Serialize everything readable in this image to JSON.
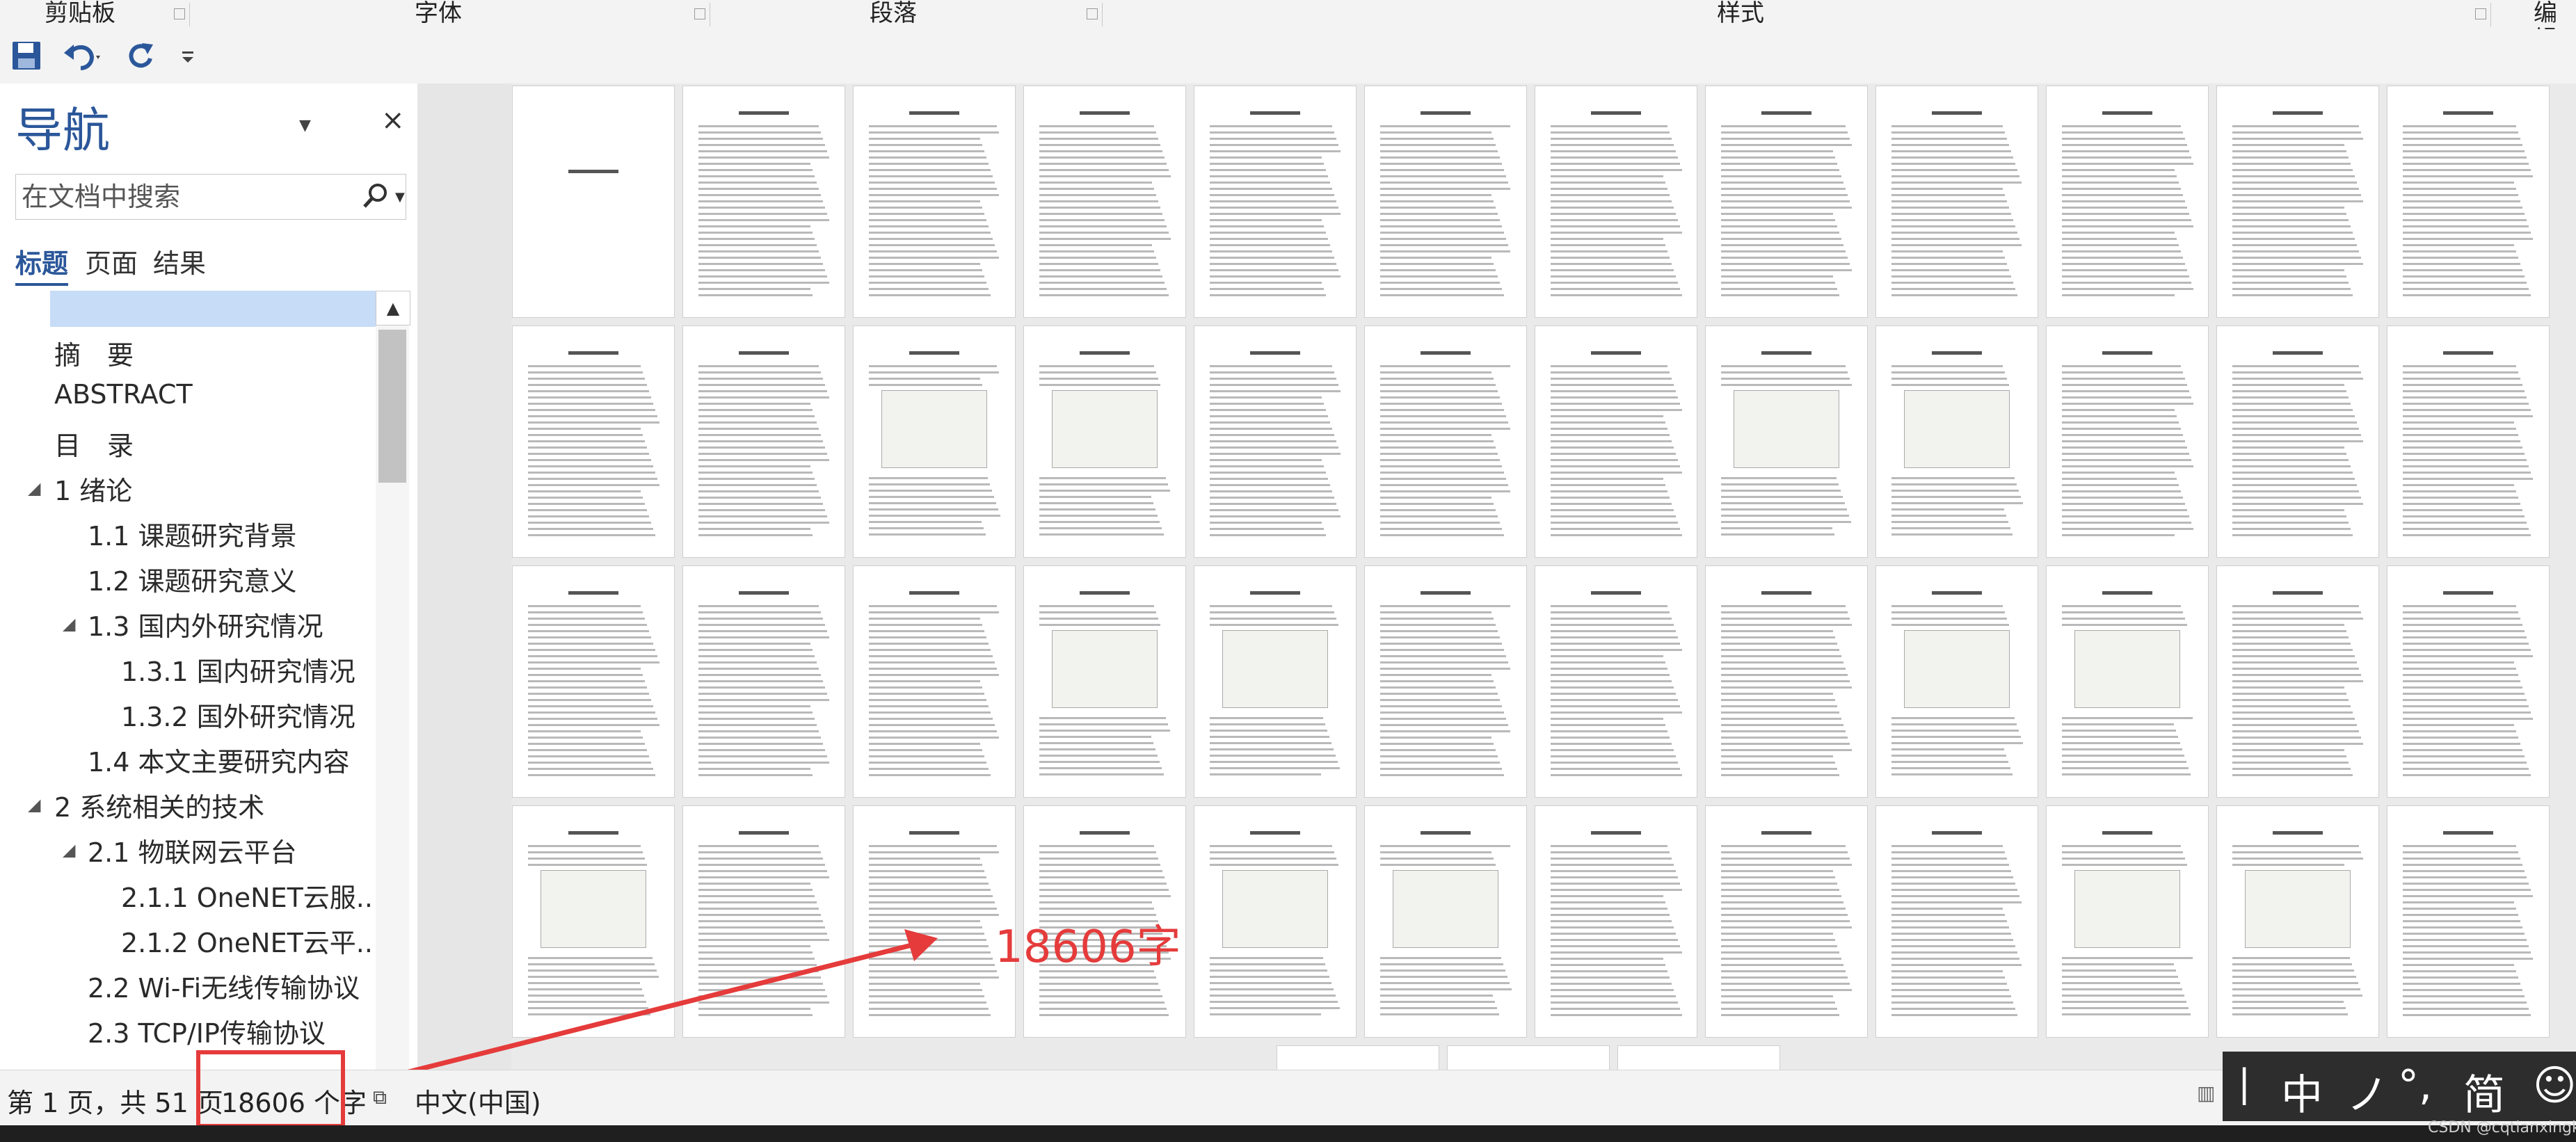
{
  "ribbon": {
    "groups": [
      {
        "label": "剪贴板"
      },
      {
        "label": "字体"
      },
      {
        "label": "段落"
      },
      {
        "label": "样式"
      },
      {
        "label": "编辑"
      }
    ]
  },
  "qat": {
    "icons": [
      "save-icon",
      "undo-icon",
      "redo-icon",
      "customize-icon"
    ]
  },
  "nav": {
    "title": "导航",
    "search_placeholder": "在文档中搜索",
    "tabs": [
      "标题",
      "页面",
      "结果"
    ],
    "items": [
      {
        "label": "摘　要",
        "level": 1
      },
      {
        "label": "ABSTRACT",
        "level": 1
      },
      {
        "label": "目　录",
        "level": 1
      },
      {
        "label": "1 绪论",
        "level": 1,
        "expanded": true
      },
      {
        "label": "1.1 课题研究背景",
        "level": 2
      },
      {
        "label": "1.2 课题研究意义",
        "level": 2
      },
      {
        "label": "1.3 国内外研究情况",
        "level": 2,
        "expanded": true
      },
      {
        "label": "1.3.1 国内研究情况",
        "level": 3
      },
      {
        "label": "1.3.2 国外研究情况",
        "level": 3
      },
      {
        "label": "1.4 本文主要研究内容",
        "level": 2
      },
      {
        "label": "2 系统相关的技术",
        "level": 1,
        "expanded": true
      },
      {
        "label": "2.1 物联网云平台",
        "level": 2,
        "expanded": true
      },
      {
        "label": "2.1.1 OneNET云服...",
        "level": 3
      },
      {
        "label": "2.1.2 OneNET云平...",
        "level": 3
      },
      {
        "label": "2.2 Wi-Fi无线传输协议",
        "level": 2
      },
      {
        "label": "2.3 TCP/IP传输协议",
        "level": 2
      }
    ]
  },
  "annotation": {
    "text": "18606字"
  },
  "status": {
    "page_info": "第 1 页，共 51 页",
    "word_count": "18606 个字",
    "language": "中文(中国)"
  },
  "ime": {
    "glyphs": [
      "中",
      "ノ",
      "°,",
      "简",
      "☺"
    ]
  },
  "watermark": "CSDN @cqtianxingkeji"
}
